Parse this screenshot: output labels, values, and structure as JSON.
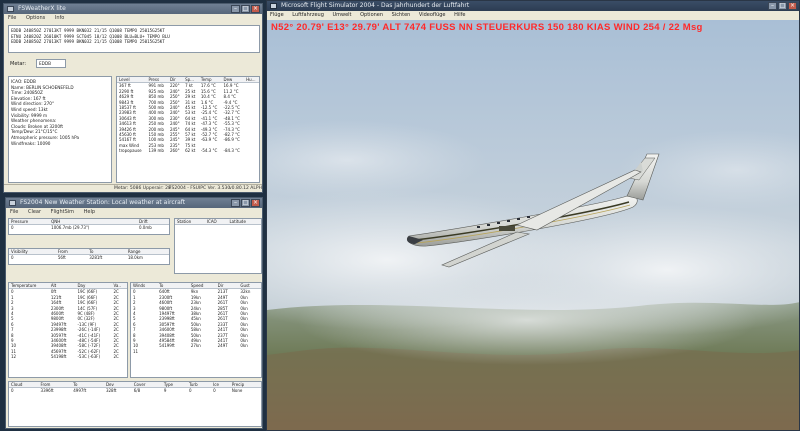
{
  "fswx": {
    "title": "FSWeatherX lite",
    "menu": [
      "File",
      "Options",
      "Info"
    ],
    "metar_lines": [
      "EDDB 240850Z 27013KT 9999 BKN032 21/15 Q1008 TEMPO 25015G25KT",
      "ETNU 240820Z 26010KT 9999 SCT045 18/12 Q1008 BLU=BLU+ TEMPO BLU",
      "EDDB 240850Z 27013KT 9999 BKN032 21/15 Q1008 TEMPO 25015G25KT"
    ],
    "metar_label": "Metar:",
    "metar_value": "EDDB",
    "station_info": [
      "ICAO: EDDB",
      "Name: BERLIN SCHOENEFELD",
      "Time: 240850Z",
      "Elevation: 167 ft",
      "Wind direction: 270°",
      "Wind speed: 13kt",
      "Visibility: 9999 m",
      "Weather phenomena:",
      "Clouds: Broken at 3200ft",
      "Temp/Dew: 21°C/15°C",
      "Atmospheric pressure: 1005 hPa",
      "Windfreaks: 10090"
    ],
    "layers_table": {
      "headers": [
        "Level",
        "Press",
        "Dir",
        "Sp...",
        "Temp",
        "Dew",
        "Hu..."
      ],
      "rows": [
        [
          "367 ft",
          "991 mb",
          "220°",
          "7 kt",
          "17.6 °C",
          "16.9 °C",
          ""
        ],
        [
          "2290 ft",
          "925 mb",
          "240°",
          "25 kt",
          "15.6 °C",
          "11.2 °C",
          ""
        ],
        [
          "4629 ft",
          "850 mb",
          "250°",
          "29 kt",
          "10.4 °C",
          "8.4 °C",
          ""
        ],
        [
          "9843 ft",
          "700 mb",
          "250°",
          "31 kt",
          "1.6 °C",
          "-9.4 °C",
          ""
        ],
        [
          "18537 ft",
          "500 mb",
          "240°",
          "45 kt",
          "-12.5 °C",
          "-22.5 °C",
          ""
        ],
        [
          "23983 ft",
          "400 mb",
          "240°",
          "53 kt",
          "-25.4 °C",
          "-32.7 °C",
          ""
        ],
        [
          "30643 ft",
          "300 mb",
          "230°",
          "64 kt",
          "-41.1 °C",
          "-48.1 °C",
          ""
        ],
        [
          "34613 ft",
          "250 mb",
          "240°",
          "74 kt",
          "-47.3 °C",
          "-55.3 °C",
          ""
        ],
        [
          "39426 ft",
          "200 mb",
          "245°",
          "64 kt",
          "-49.3 °C",
          "-74.3 °C",
          ""
        ],
        [
          "45630 ft",
          "150 mb",
          "255°",
          "57 kt",
          "-52.7 °C",
          "-82.7 °C",
          ""
        ],
        [
          "54167 ft",
          "100 mb",
          "245°",
          "39 kt",
          "-63.9 °C",
          "-86.9 °C",
          ""
        ],
        [
          "max Wind",
          "253 mb",
          "235°",
          "75 kt",
          "",
          "",
          ""
        ],
        [
          "tropopause",
          "139 mb",
          "260°",
          "62 kt",
          "-54.3 °C",
          "-84.3 °C",
          ""
        ]
      ]
    },
    "status": [
      "Metar: 5086 Upperair: 28",
      "FS2004 - FSUIPC Ver. 3.530",
      "v0.80.12 ALPHA"
    ]
  },
  "nws": {
    "title": "FS2004 New Weather Station: Local weather at aircraft",
    "menu": [
      "File",
      "Clear",
      "FlightSim",
      "Help"
    ],
    "pressure": {
      "headers": [
        "Pressure",
        "QNH",
        "",
        "Drift"
      ],
      "row": [
        "0",
        "1006.7mb (29.73\")",
        "",
        "0.0mb"
      ]
    },
    "station": {
      "headers": [
        "Station",
        "ICAO",
        "Latitude"
      ],
      "rows": []
    },
    "visibility": {
      "headers": [
        "Visibility",
        "From",
        "To",
        "Range"
      ],
      "row": [
        "0",
        "56ft",
        "3281ft",
        "18.0km"
      ]
    },
    "temperature": {
      "headers": [
        "Temperature",
        "Alt",
        "Day",
        "Va.."
      ],
      "rows": [
        [
          "0",
          "0ft",
          "19C (66F)",
          "2C"
        ],
        [
          "1",
          "121ft",
          "19C (66F)",
          "2C"
        ],
        [
          "2",
          "164ft",
          "19C (66F)",
          "2C"
        ],
        [
          "3",
          "2300ft",
          "14C (57F)",
          "2C"
        ],
        [
          "4",
          "4600ft",
          "9C (48F)",
          "2C"
        ],
        [
          "5",
          "9800ft",
          "0C (32F)",
          "2C"
        ],
        [
          "6",
          "19497ft",
          "-13C (9F)",
          "2C"
        ],
        [
          "7",
          "23998ft",
          "-26C (-14F)",
          "2C"
        ],
        [
          "8",
          "30597ft",
          "-41C (-41F)",
          "2C"
        ],
        [
          "9",
          "34600ft",
          "-48C (-54F)",
          "2C"
        ],
        [
          "10",
          "39408ft",
          "-58C (-72F)",
          "2C"
        ],
        [
          "11",
          "45697ft",
          "-52C (-62F)",
          "2C"
        ],
        [
          "12",
          "54198ft",
          "-53C (-63F)",
          "2C"
        ]
      ]
    },
    "winds": {
      "headers": [
        "Winds",
        "To",
        "Speed",
        "Dir",
        "Gust"
      ],
      "rows": [
        [
          "0",
          "640ft",
          "9kn",
          "213T",
          "32kn"
        ],
        [
          "1",
          "2300ft",
          "19kn",
          "249T",
          "0kn"
        ],
        [
          "2",
          "4600ft",
          "23kn",
          "261T",
          "0kn"
        ],
        [
          "3",
          "9800ft",
          "24kn",
          "285T",
          "0kn"
        ],
        [
          "4",
          "19497ft",
          "38kn",
          "261T",
          "0kn"
        ],
        [
          "5",
          "23998ft",
          "45kn",
          "261T",
          "0kn"
        ],
        [
          "6",
          "30597ft",
          "50kn",
          "233T",
          "0kn"
        ],
        [
          "7",
          "34600ft",
          "58kn",
          "241T",
          "0kn"
        ],
        [
          "8",
          "39408ft",
          "50kn",
          "237T",
          "0kn"
        ],
        [
          "9",
          "49584ft",
          "49kn",
          "241T",
          "0kn"
        ],
        [
          "10",
          "54199ft",
          "27kn",
          "249T",
          "0kn"
        ],
        [
          "11",
          "",
          "",
          "",
          ""
        ]
      ]
    },
    "clouds": {
      "headers": [
        "Cloud",
        "From",
        "To",
        "Dev",
        "Cover",
        "Type",
        "Turb",
        "Ice",
        "Precip"
      ],
      "row": [
        "0",
        "3396ft",
        "4997ft",
        "328ft",
        "6/8",
        "9",
        "0",
        "0",
        "None"
      ]
    }
  },
  "fs2004": {
    "title": "Microsoft Flight Simulator 2004 - Das Jahrhundert der Luftfahrt",
    "menu": [
      "Flüge",
      "Luftfahrzeug",
      "Umwelt",
      "Optionen",
      "Sichten",
      "Videoflüge",
      "Hilfe"
    ],
    "hud": "N52° 20.79'  E13° 29.79'  ALT  7474 FUSS NN  STEUERKURS 150   180 KIAS  WIND 254 / 22 Msg"
  },
  "colors": {
    "hud": "#ff2a2a",
    "sky_top": "#a8c2dc",
    "ground": "#6b7a52"
  },
  "icons": [
    "window-icon",
    "minimize-icon",
    "maximize-icon",
    "close-icon"
  ]
}
